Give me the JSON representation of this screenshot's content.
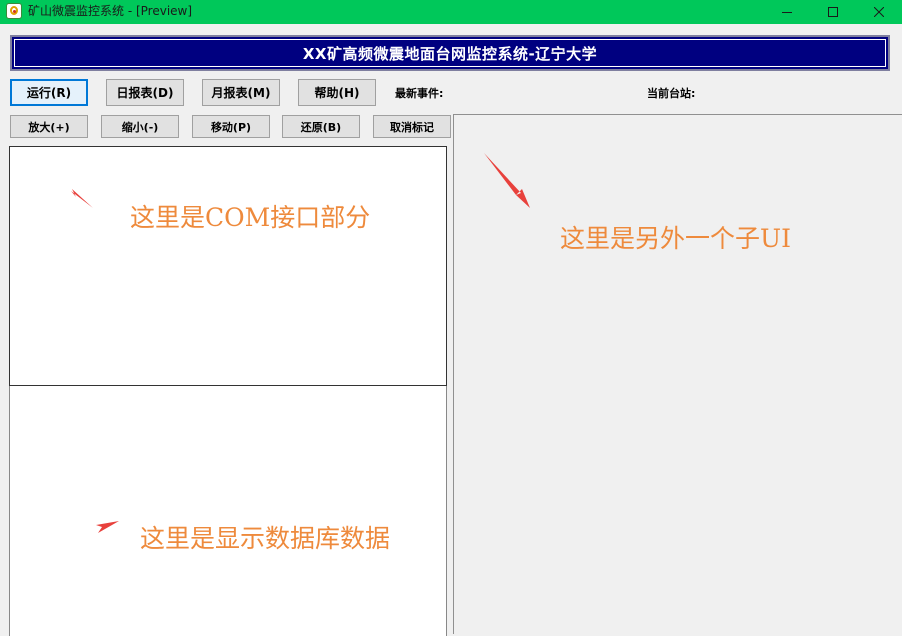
{
  "window": {
    "title": "矿山微震监控系统  - [Preview]",
    "icon": "app-icon",
    "controls": [
      "minimize-icon",
      "maximize-icon",
      "close-icon"
    ]
  },
  "banner": {
    "title": "XX矿高频微震地面台网监控系统-辽宁大学"
  },
  "toolbar": {
    "run": "运行(R)",
    "daily_report": "日报表(D)",
    "monthly_report": "月报表(M)",
    "help": "帮助(H)",
    "latest_event_label": "最新事件:",
    "current_station_label": "当前台站:"
  },
  "view_toolbar": {
    "zoom_in": "放大(+)",
    "zoom_out": "缩小(-)",
    "move": "移动(P)",
    "restore": "还原(B)",
    "clear_marks": "取消标记"
  },
  "annotations": {
    "com": "这里是COM接口部分",
    "sub_ui": "这里是另外一个子UI",
    "db": "这里是显示数据库数据"
  },
  "colors": {
    "titlebar": "#00c85a",
    "banner": "#000080",
    "annotation_text": "#ee8a3c",
    "arrow": "#e8413c"
  }
}
